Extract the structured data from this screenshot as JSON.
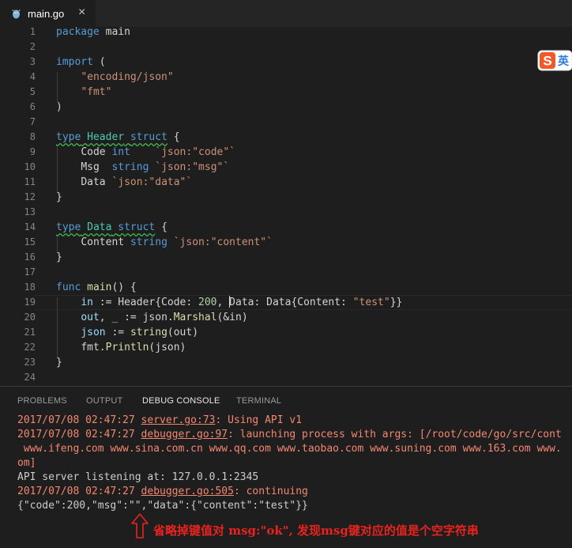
{
  "tab": {
    "filename": "main.go",
    "close_glyph": "×"
  },
  "ime_badge": {
    "letter": "S",
    "tail": "英"
  },
  "code_lines": [
    {
      "n": "1"
    },
    {
      "n": "2"
    },
    {
      "n": "3"
    },
    {
      "n": "4"
    },
    {
      "n": "5"
    },
    {
      "n": "6"
    },
    {
      "n": "7"
    },
    {
      "n": "8"
    },
    {
      "n": "9"
    },
    {
      "n": "10"
    },
    {
      "n": "11"
    },
    {
      "n": "12"
    },
    {
      "n": "13"
    },
    {
      "n": "14"
    },
    {
      "n": "15"
    },
    {
      "n": "16"
    },
    {
      "n": "17"
    },
    {
      "n": "18"
    },
    {
      "n": "19"
    },
    {
      "n": "20"
    },
    {
      "n": "21"
    },
    {
      "n": "22"
    },
    {
      "n": "23"
    },
    {
      "n": "24"
    }
  ],
  "code": {
    "l1": {
      "kw": "package",
      "name": "main"
    },
    "l3": {
      "kw": "import",
      "paren": "("
    },
    "l4": {
      "str": "\"encoding/json\""
    },
    "l5": {
      "str": "\"fmt\""
    },
    "l6": {
      "paren": ")"
    },
    "l8": {
      "kw": "type",
      "name": "Header",
      "kw2": "struct",
      "brace": "{"
    },
    "l9": {
      "field": "Code",
      "type": "int",
      "tag": "`json:\"code\"`"
    },
    "l10": {
      "field": "Msg",
      "type": "string",
      "tag": "`json:\"msg\"`"
    },
    "l11": {
      "field": "Data",
      "tag": "`json:\"data\"`"
    },
    "l12": {
      "brace": "}"
    },
    "l14": {
      "kw": "type",
      "name": "Data",
      "kw2": "struct",
      "brace": "{"
    },
    "l15": {
      "field": "Content",
      "type": "string",
      "tag": "`json:\"content\"`"
    },
    "l16": {
      "brace": "}"
    },
    "l18": {
      "kw": "func",
      "name": "main",
      "rest": "() {"
    },
    "l19": {
      "var": "in",
      "p1": " := Header{Code: ",
      "num": "200",
      "p2": ", ",
      "p3": "Data: Data{Content: ",
      "str": "\"test\"",
      "p4": "}}"
    },
    "l20": {
      "var1": "out",
      "p1": ", ",
      "var2": "_",
      "p2": " := json.",
      "fn": "Marshal",
      "p3": "(&in)"
    },
    "l21": {
      "var": "json",
      "p1": " := ",
      "fn": "string",
      "p2": "(out)"
    },
    "l22": {
      "p1": "fmt.",
      "fn": "Println",
      "p2": "(json)"
    },
    "l23": {
      "brace": "}"
    }
  },
  "panel": {
    "tabs": [
      {
        "label": "PROBLEMS"
      },
      {
        "label": "OUTPUT"
      },
      {
        "label": "DEBUG CONSOLE"
      },
      {
        "label": "TERMINAL"
      }
    ],
    "console": {
      "l1": {
        "ts": "2017/07/08 02:47:27 ",
        "link": "server.go:73",
        "msg": ": Using API v1"
      },
      "l2": {
        "ts": "2017/07/08 02:47:27 ",
        "link": "debugger.go:97",
        "msg": ": launching process with args: [/root/code/go/src/cont"
      },
      "l3": {
        "text": " www.ifeng.com www.sina.com.cn www.qq.com www.taobao.com www.suning.com www.163.com www."
      },
      "l4": {
        "text": "om]"
      },
      "l5": {
        "text": "API server listening at: 127.0.0.1:2345"
      },
      "l6": {
        "ts": "2017/07/08 02:47:27 ",
        "link": "debugger.go:505",
        "msg": ": continuing"
      },
      "l7": {
        "text": "{\"code\":200,\"msg\":\"\",\"data\":{\"content\":\"test\"}}"
      }
    }
  },
  "annotation": {
    "text": "省略掉键值对 msg:\"ok\", 发现msg键对应的值是个空字符串",
    "color": "#e8231f"
  }
}
